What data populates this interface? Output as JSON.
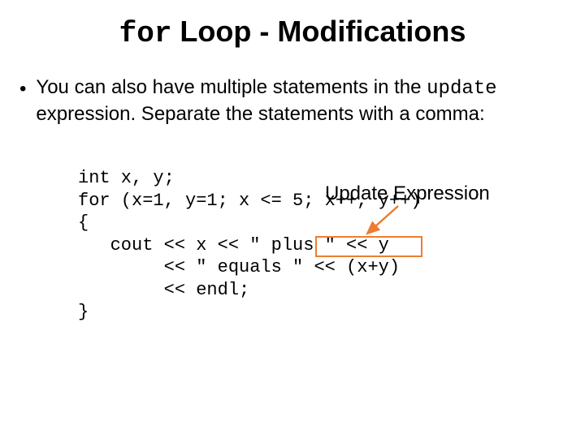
{
  "title": {
    "code": "for",
    "rest": " Loop - Modifications"
  },
  "bullet": {
    "dot": "•",
    "part1": "You can also have multiple statements in the ",
    "code": "update",
    "part2": " expression. Separate the statements with a comma:"
  },
  "annotation": "Update Expression",
  "code": {
    "l1": "int x, y;",
    "l2": "for (x=1, y=1; x <= 5; x++, y++)",
    "l3": "{",
    "l4": "   cout << x << \" plus \" << y",
    "l5": "        << \" equals \" << (x+y)",
    "l6": "        << endl;",
    "l7": "}"
  }
}
